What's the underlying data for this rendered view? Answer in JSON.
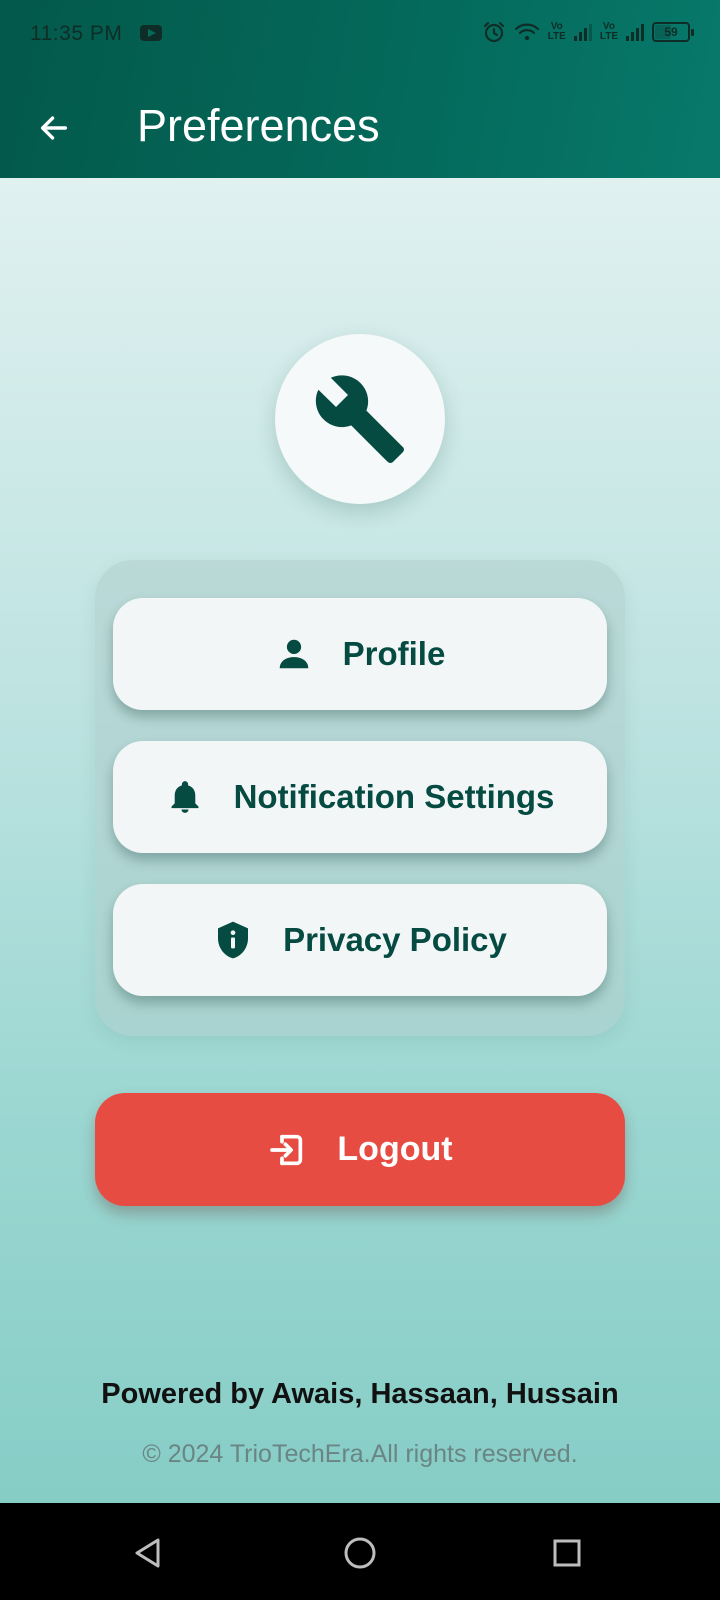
{
  "status_bar": {
    "time": "11:35 PM",
    "battery": "59",
    "network_label_1": "Vo\nLTE",
    "network_label_2": "Vo\nLTE"
  },
  "app_bar": {
    "title": "Preferences",
    "back_icon": "arrow-left-icon"
  },
  "header_icon": "wrench-icon",
  "menu": [
    {
      "label": "Profile",
      "icon": "person-icon"
    },
    {
      "label": "Notification Settings",
      "icon": "bell-icon"
    },
    {
      "label": "Privacy Policy",
      "icon": "shield-info-icon"
    }
  ],
  "logout": {
    "label": "Logout",
    "icon": "logout-icon"
  },
  "footer": {
    "powered_by": "Powered by Awais, Hassaan, Hussain",
    "copyright": "© 2024 TrioTechEra.All rights reserved."
  },
  "colors": {
    "app_bar": "#04695a",
    "accent_text": "#054b41",
    "logout": "#e74c43",
    "background_top": "#e0f1f0",
    "background_bottom": "#86cdc6"
  }
}
